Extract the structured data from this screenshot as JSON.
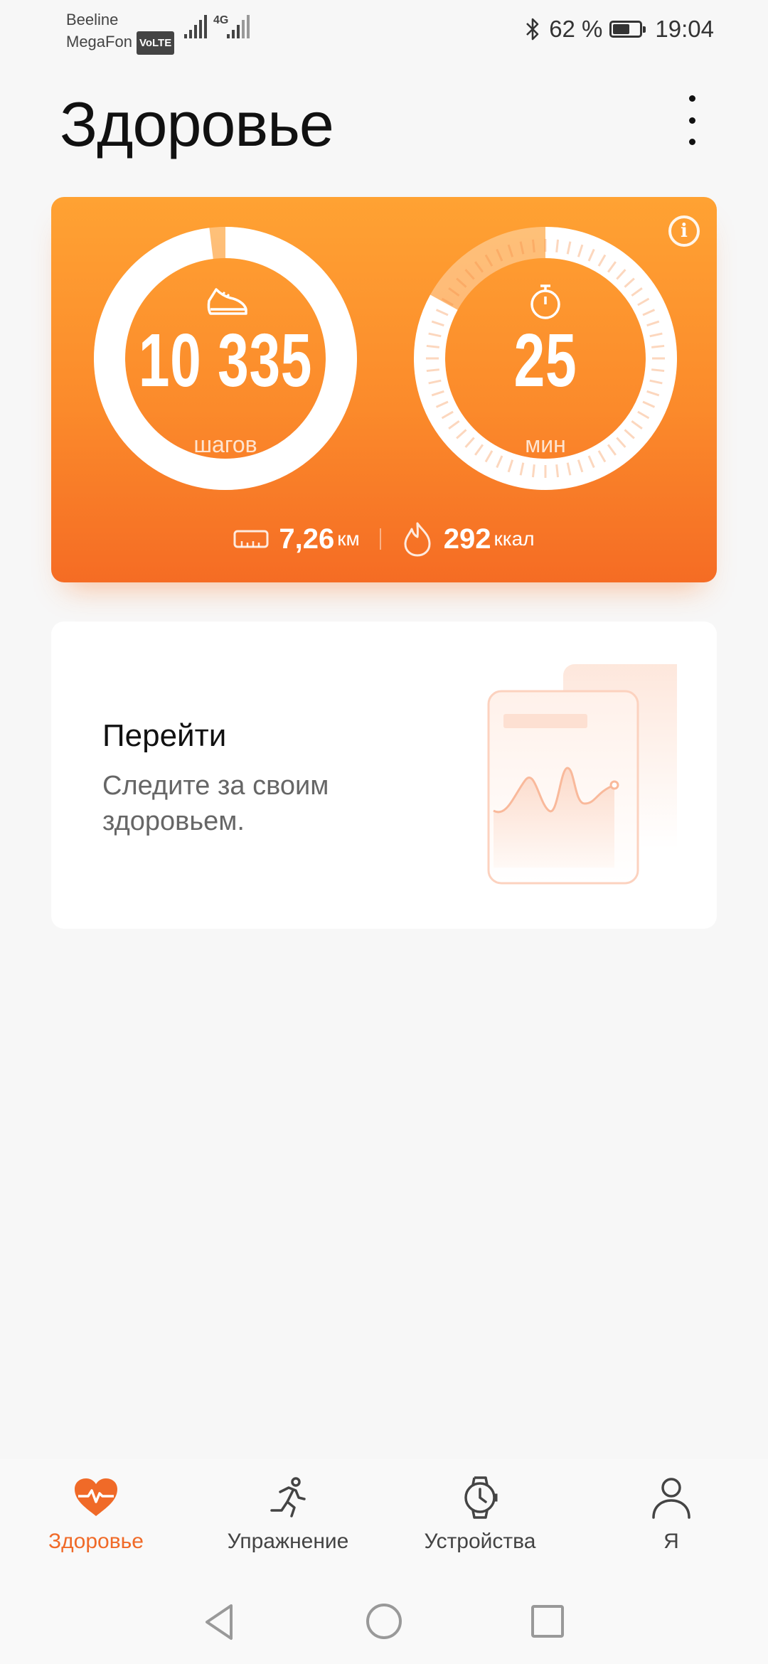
{
  "status_bar": {
    "carrier1": "Beeline",
    "carrier2": "MegaFon",
    "volte": "VoLTE",
    "network": "4G",
    "battery_percent": "62 %",
    "battery_level": 0.62,
    "time": "19:04"
  },
  "header": {
    "title": "Здоровье"
  },
  "activity": {
    "steps_value": "10 335",
    "steps_unit": "шагов",
    "steps_progress": 0.98,
    "minutes_value": "25",
    "minutes_unit": "мин",
    "minutes_progress": 0.83,
    "distance_value": "7,26",
    "distance_unit": "км",
    "calories_value": "292",
    "calories_unit": "ккал"
  },
  "promo": {
    "title": "Перейти",
    "subtitle": "Следите за своим здоровьем."
  },
  "bottom_nav": {
    "items": [
      {
        "label": "Здоровье",
        "icon": "heart-pulse-icon",
        "active": true
      },
      {
        "label": "Упражнение",
        "icon": "running-icon",
        "active": false
      },
      {
        "label": "Устройства",
        "icon": "watch-icon",
        "active": false
      },
      {
        "label": "Я",
        "icon": "person-icon",
        "active": false
      }
    ]
  },
  "colors": {
    "accent": "#f06a28",
    "card_top": "#ffa233",
    "card_bottom": "#f56c24"
  }
}
